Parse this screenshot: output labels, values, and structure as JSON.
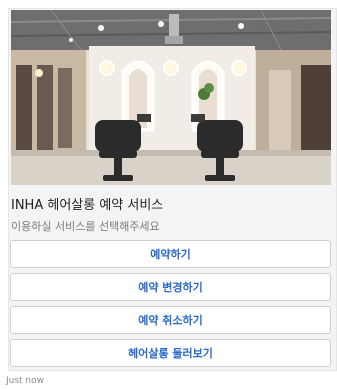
{
  "card": {
    "title": "INHA 헤어살롱 예약 서비스",
    "subtitle": "이용하실 서비스를 선택해주세요",
    "buttons": [
      {
        "label": "예약하기"
      },
      {
        "label": "예약 변경하기"
      },
      {
        "label": "예약 취소하기"
      },
      {
        "label": "헤어살롱 둘러보기"
      }
    ]
  },
  "message": {
    "timestamp": "Just now"
  },
  "colors": {
    "button_text": "#2a6acb",
    "card_bg": "#f4f4f4"
  }
}
